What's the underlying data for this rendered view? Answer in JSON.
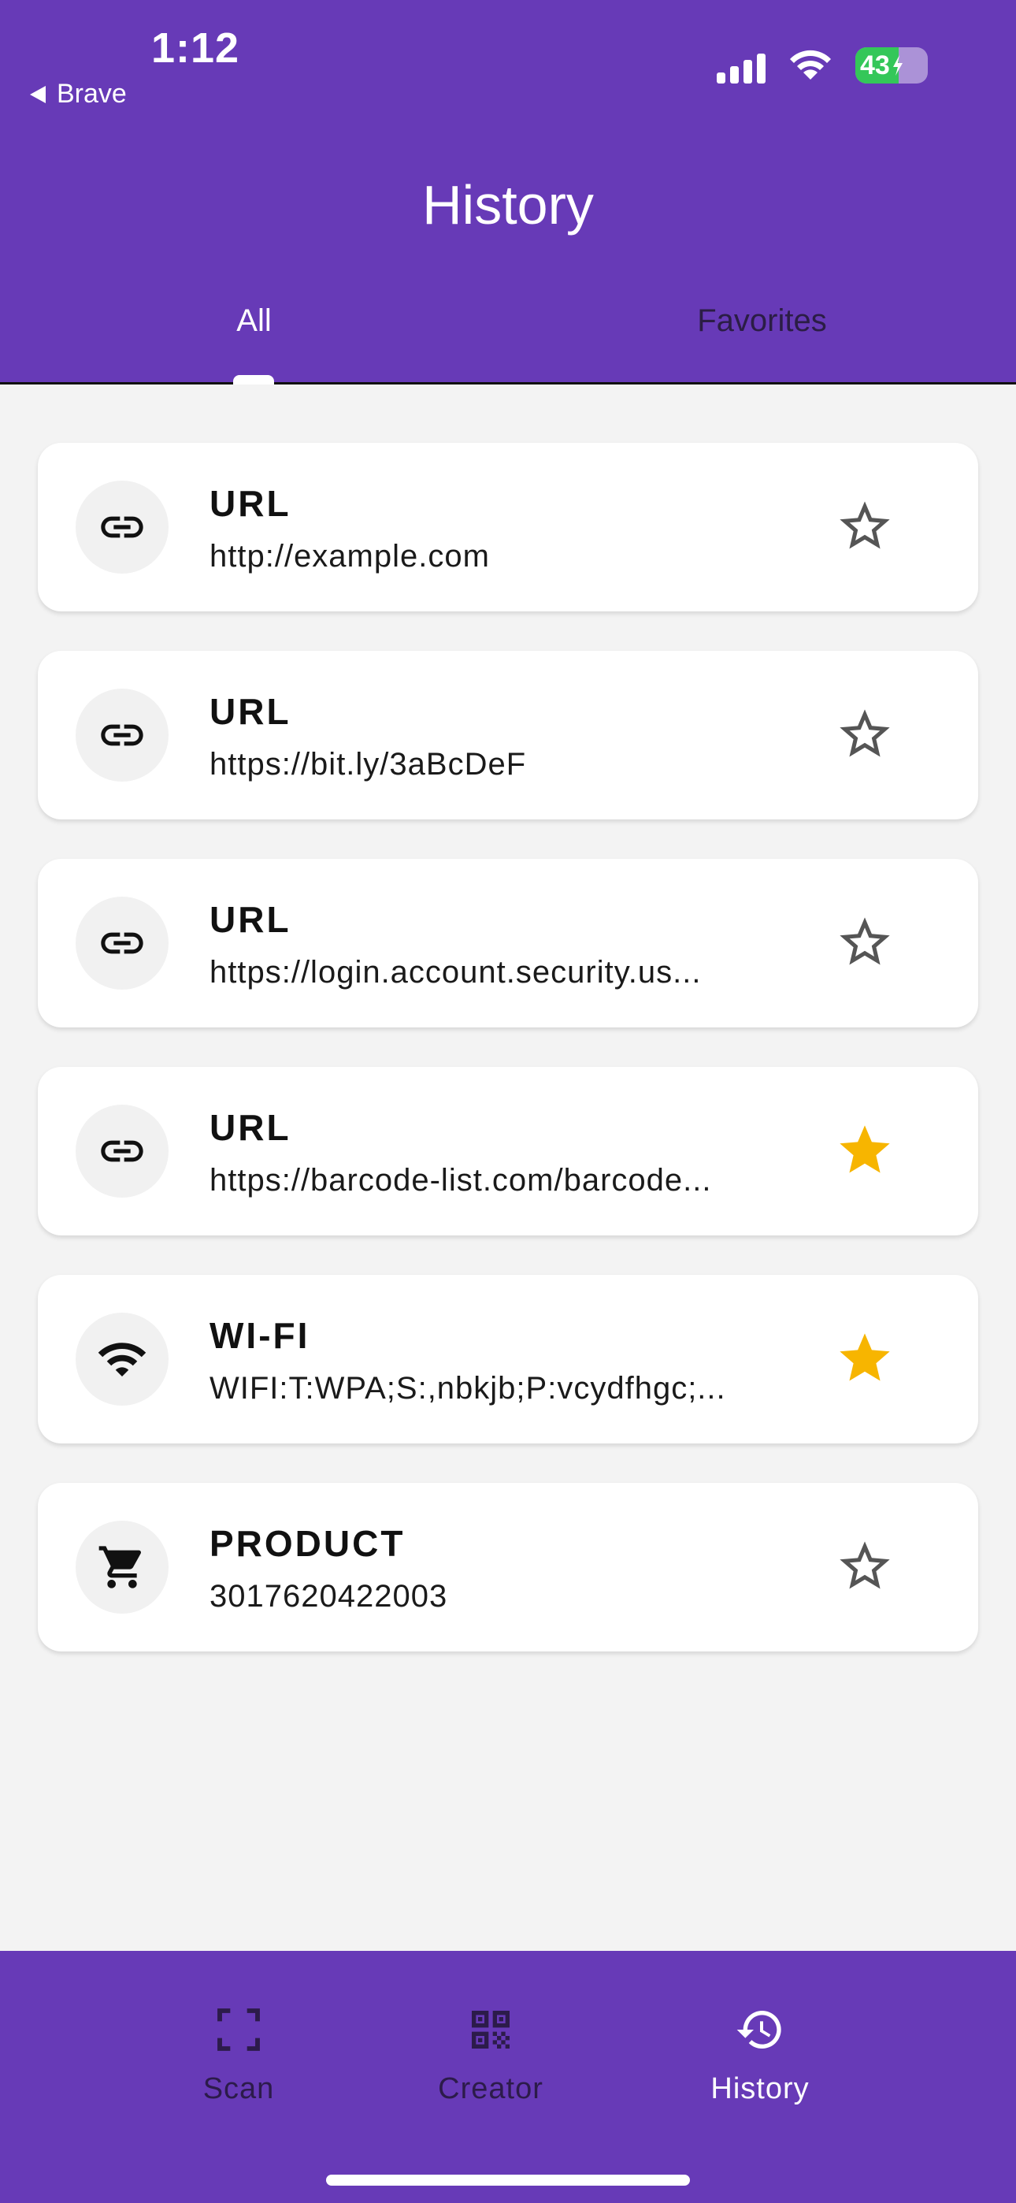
{
  "status_bar": {
    "time": "1:12",
    "back_app": "Brave",
    "battery_level": "43"
  },
  "header": {
    "title": "History",
    "tabs": [
      {
        "label": "All",
        "selected": true
      },
      {
        "label": "Favorites",
        "selected": false
      }
    ]
  },
  "history": [
    {
      "type": "URL",
      "value": "http://example.com",
      "icon": "link-icon",
      "favorite": false
    },
    {
      "type": "URL",
      "value": "https://bit.ly/3aBcDeF",
      "icon": "link-icon",
      "favorite": false
    },
    {
      "type": "URL",
      "value": "https://login.account.security.us...",
      "icon": "link-icon",
      "favorite": false
    },
    {
      "type": "URL",
      "value": "https://barcode-list.com/barcode...",
      "icon": "link-icon",
      "favorite": true
    },
    {
      "type": "WI-FI",
      "value": "WIFI:T:WPA;S:,nbkjb;P:vcydfhgc;...",
      "icon": "wifi-icon",
      "favorite": true
    },
    {
      "type": "PRODUCT",
      "value": "3017620422003",
      "icon": "cart-icon",
      "favorite": false
    }
  ],
  "bottom_nav": {
    "items": [
      {
        "label": "Scan",
        "icon": "scan-icon",
        "active": false
      },
      {
        "label": "Creator",
        "icon": "qr-code-icon",
        "active": false
      },
      {
        "label": "History",
        "icon": "history-icon",
        "active": true
      }
    ]
  },
  "colors": {
    "primary": "#673ab7",
    "favorite_star": "#f7b500",
    "star_outline": "#555555"
  }
}
